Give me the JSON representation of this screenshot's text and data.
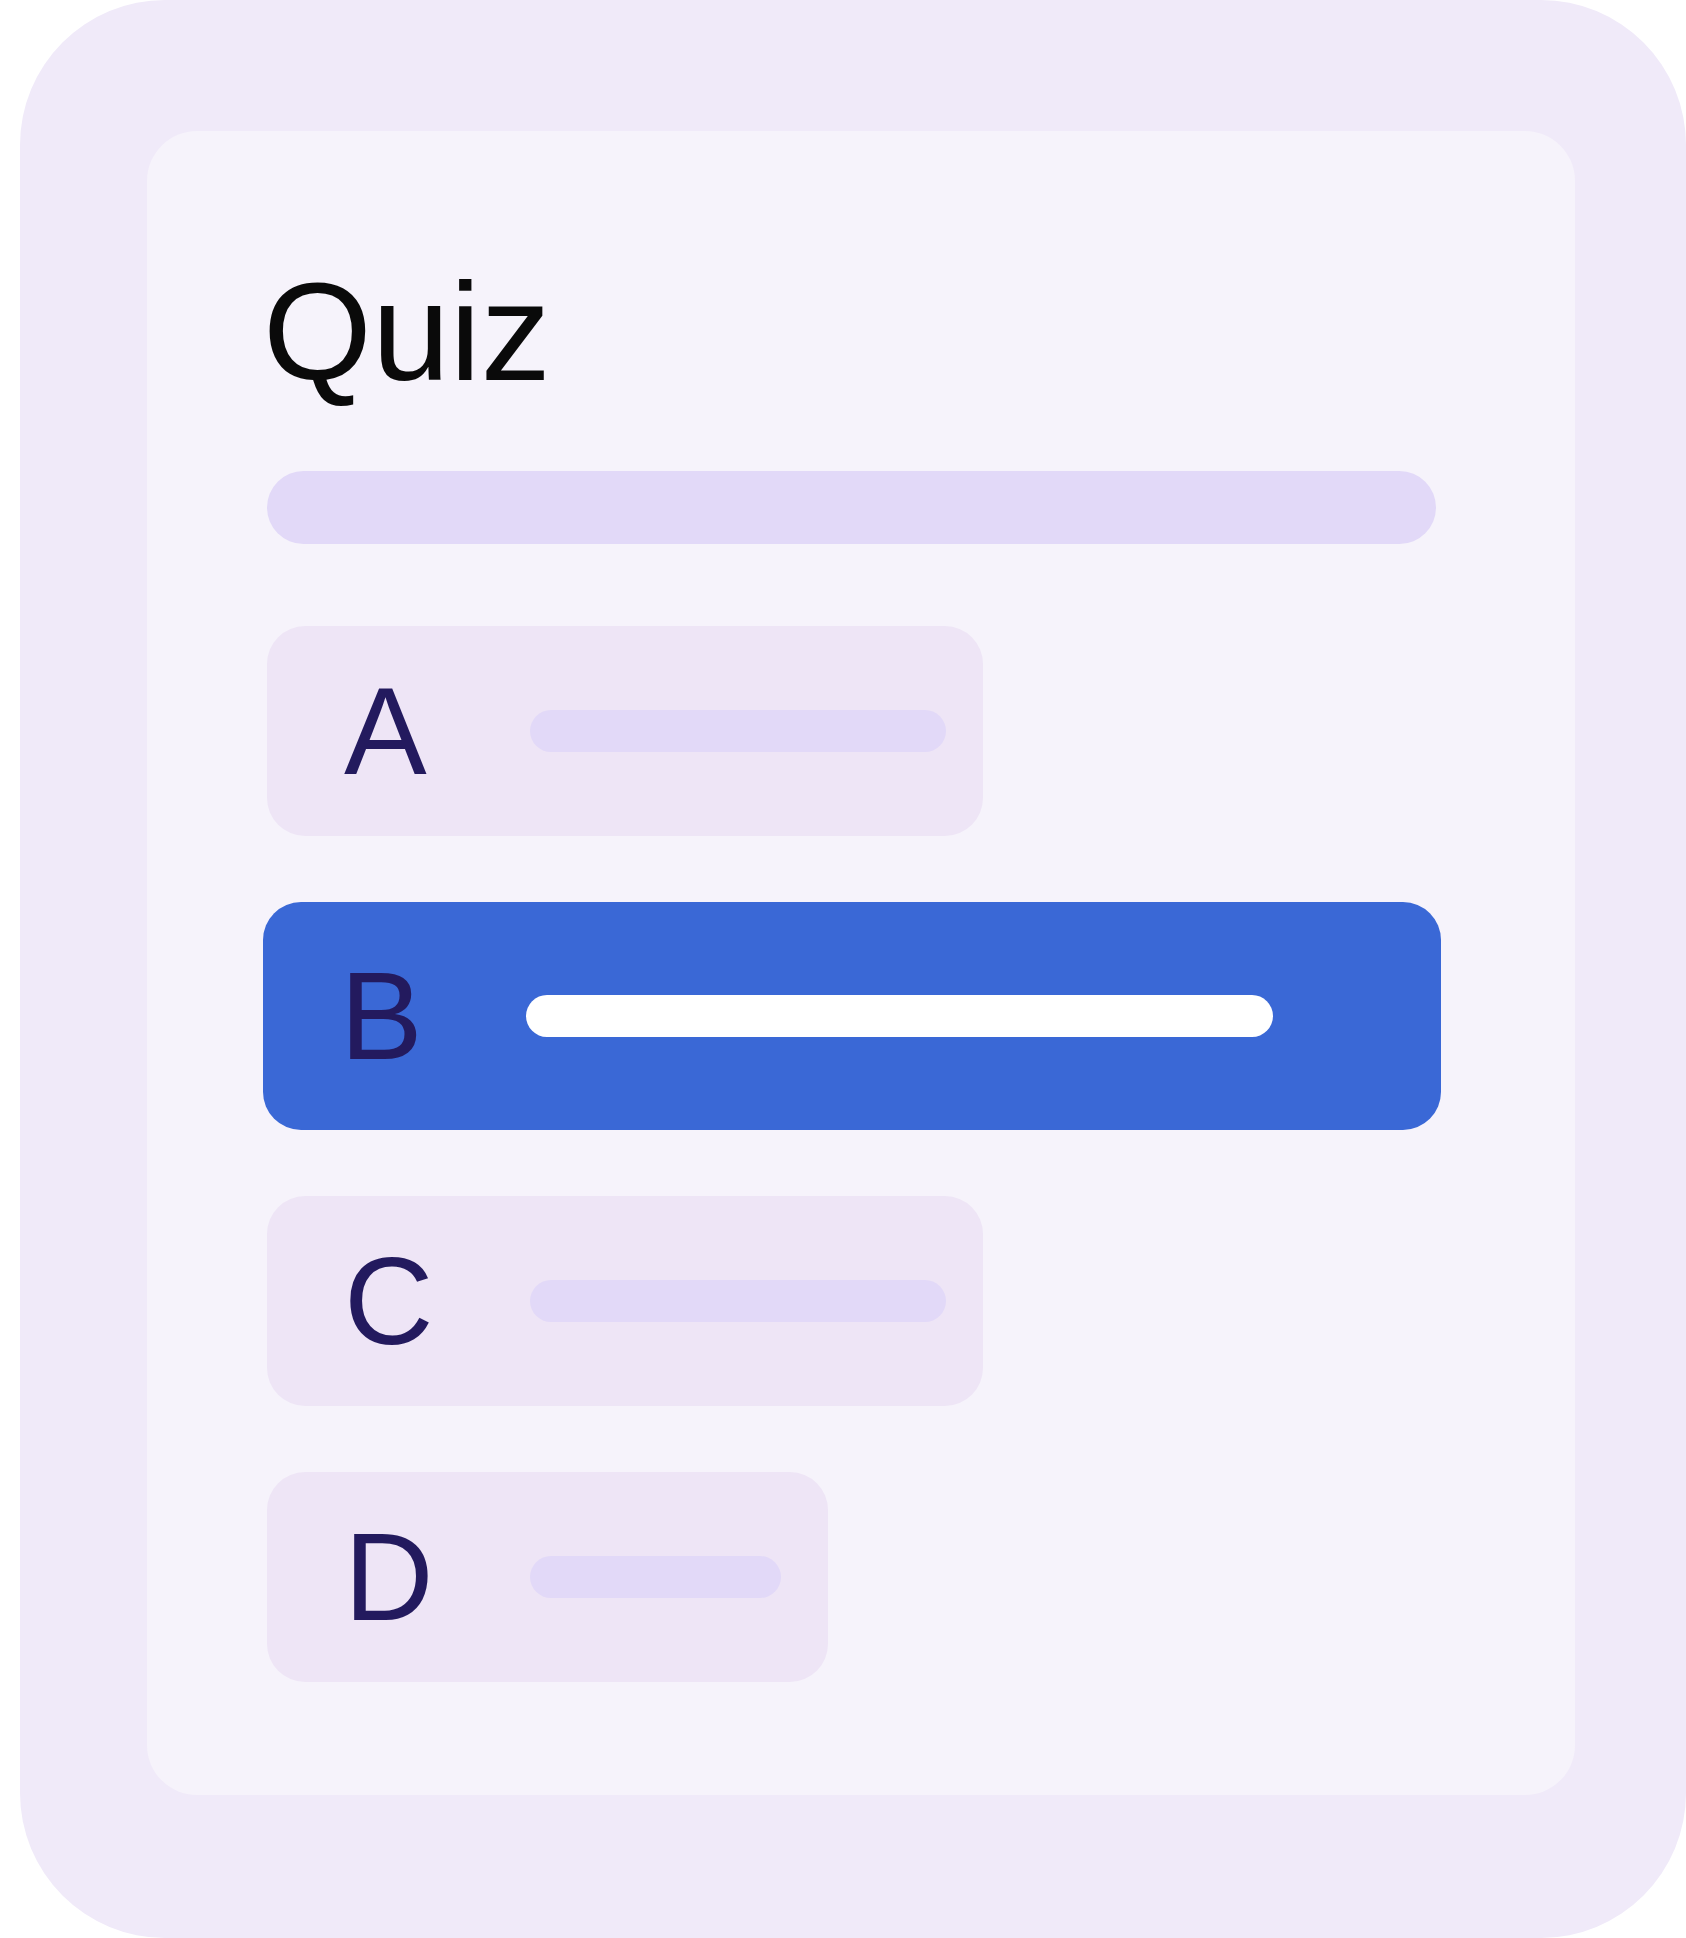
{
  "title": "Quiz",
  "options": [
    {
      "letter": "A",
      "selected": false
    },
    {
      "letter": "B",
      "selected": true
    },
    {
      "letter": "C",
      "selected": false
    },
    {
      "letter": "D",
      "selected": false
    }
  ]
}
